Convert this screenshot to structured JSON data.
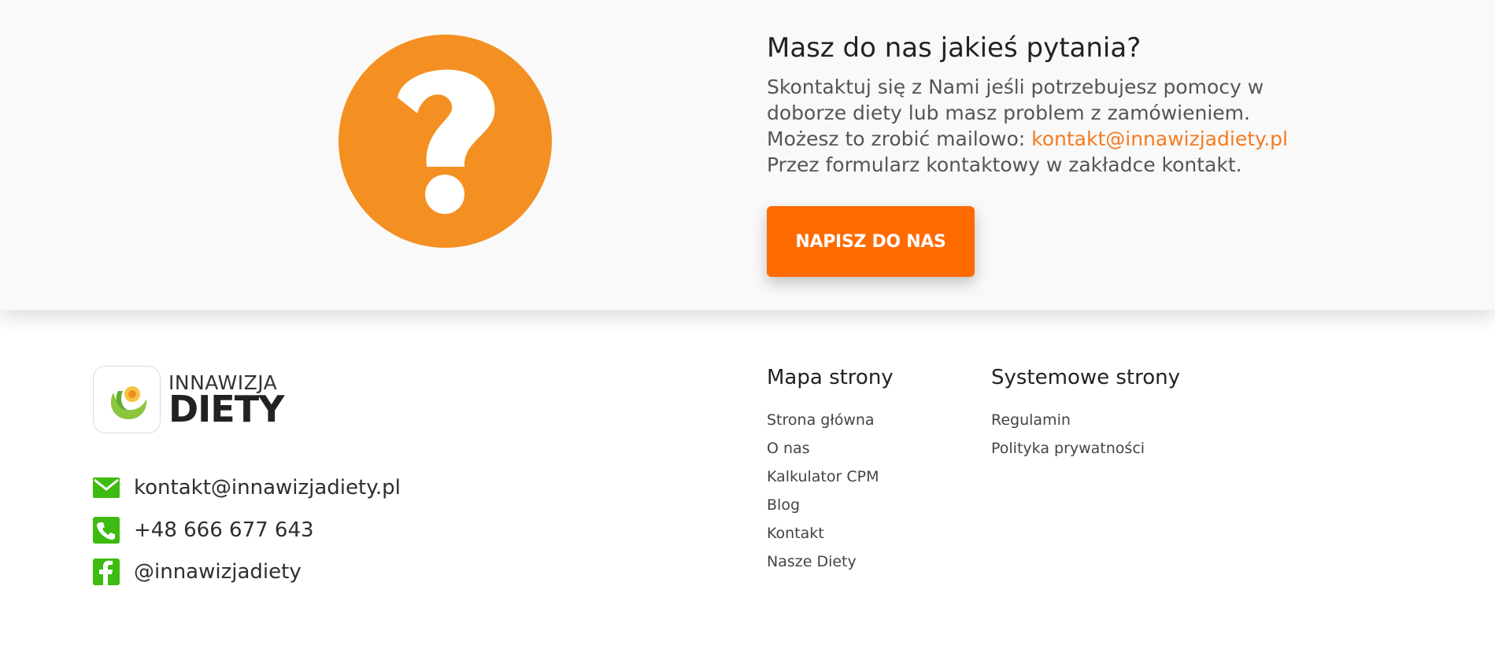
{
  "banner": {
    "title": "Masz do nas jakieś pytania?",
    "line1": "Skontaktuj się z Nami jeśli potrzebujesz pomocy w",
    "line2": "doborze diety lub masz problem z zamówieniem.",
    "line3_prefix": "Możesz to zrobić mailowo: ",
    "email_link": "kontakt@innawizjadiety.pl",
    "line4": "Przez formularz kontaktowy w zakładce kontakt.",
    "cta_label": "NAPISZ DO NAS",
    "icon": "question-mark-icon",
    "accent_color": "#f39021",
    "cta_color": "#ff6b00"
  },
  "footer": {
    "logo": {
      "top": "INNAWIZJA",
      "bottom": "DIETY"
    },
    "contacts": {
      "email": "kontakt@innawizjadiety.pl",
      "phone": "+48 666 677 643",
      "facebook": "@innawizjadiety"
    },
    "sitemap": {
      "title": "Mapa strony",
      "items": [
        "Strona główna",
        "O nas",
        "Kalkulator CPM",
        "Blog",
        "Kontakt",
        "Nasze Diety"
      ]
    },
    "system": {
      "title": "Systemowe strony",
      "items": [
        "Regulamin",
        "Polityka prywatności"
      ]
    },
    "icon_color": "#3dbb10"
  }
}
